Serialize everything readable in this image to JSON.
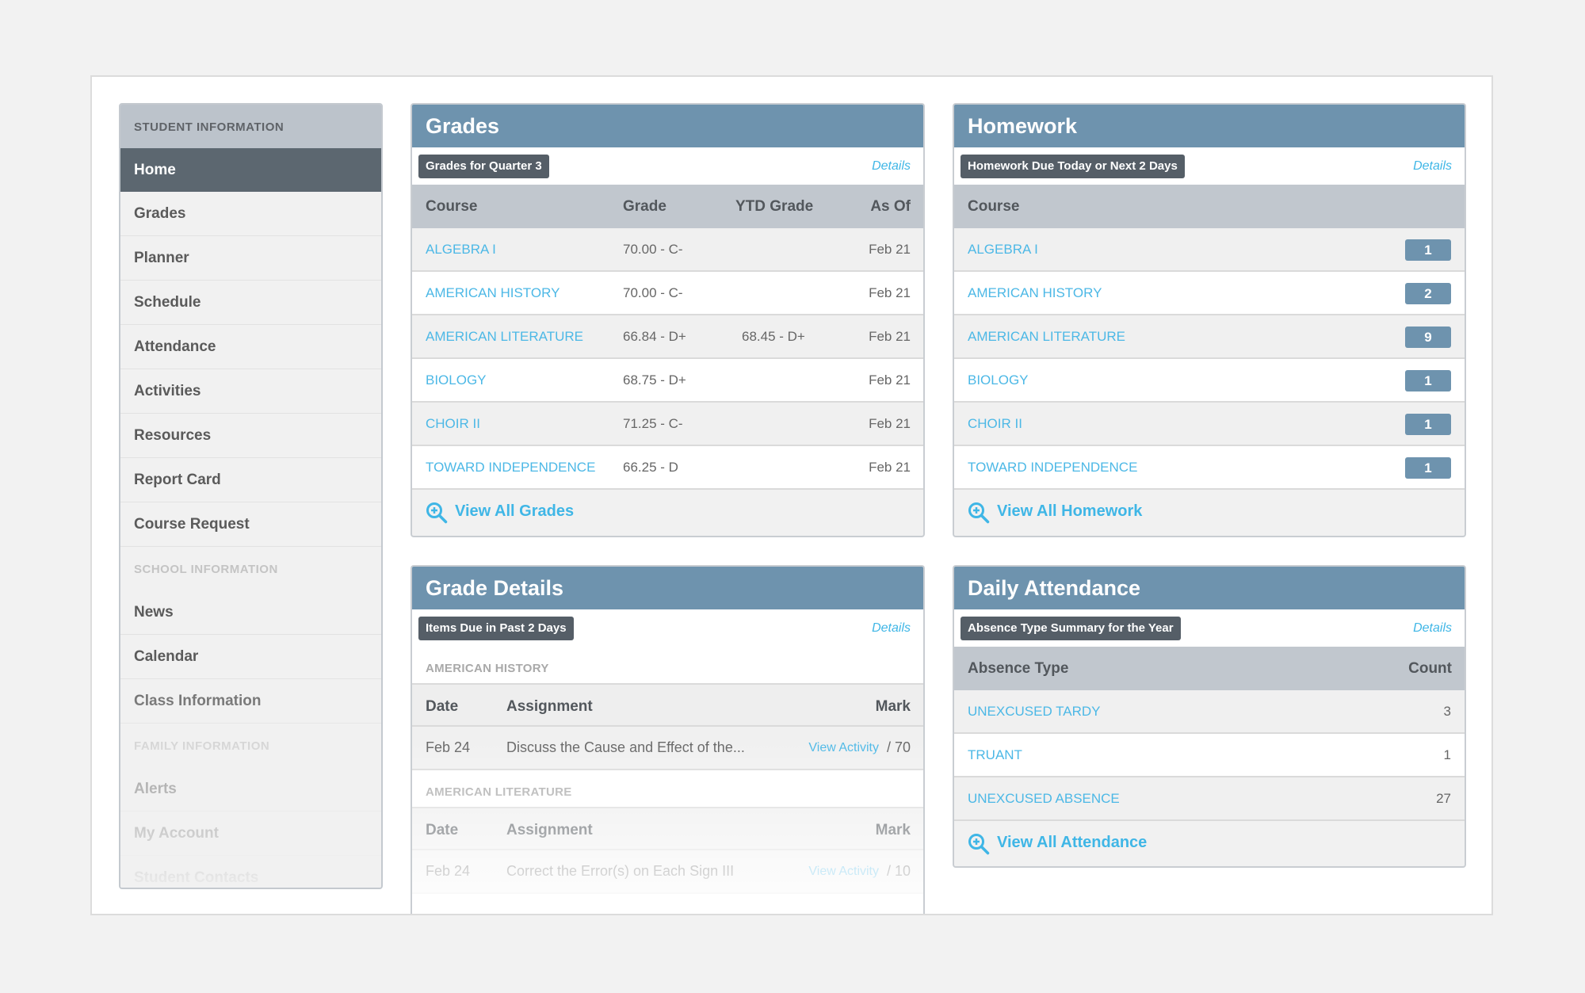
{
  "sidebar": {
    "sections": [
      {
        "title": "STUDENT INFORMATION",
        "items": [
          "Home",
          "Grades",
          "Planner",
          "Schedule",
          "Attendance",
          "Activities",
          "Resources",
          "Report Card",
          "Course Request"
        ]
      },
      {
        "title": "SCHOOL INFORMATION",
        "items": [
          "News",
          "Calendar",
          "Class Information"
        ]
      },
      {
        "title": "FAMILY INFORMATION",
        "items": [
          "Alerts",
          "My Account",
          "Student Contacts"
        ]
      }
    ],
    "active_item": "Home"
  },
  "grades": {
    "title": "Grades",
    "tag": "Grades for Quarter 3",
    "details": "Details",
    "columns": [
      "Course",
      "Grade",
      "YTD Grade",
      "As Of"
    ],
    "rows": [
      {
        "course": "ALGEBRA I",
        "grade": "70.00 - C-",
        "ytd": "",
        "asof": "Feb 21"
      },
      {
        "course": "AMERICAN HISTORY",
        "grade": "70.00 - C-",
        "ytd": "",
        "asof": "Feb 21"
      },
      {
        "course": "AMERICAN LITERATURE",
        "grade": "66.84 - D+",
        "ytd": "68.45 - D+",
        "asof": "Feb 21"
      },
      {
        "course": "BIOLOGY",
        "grade": "68.75 - D+",
        "ytd": "",
        "asof": "Feb 21"
      },
      {
        "course": "CHOIR II",
        "grade": "71.25 - C-",
        "ytd": "",
        "asof": "Feb 21"
      },
      {
        "course": "TOWARD INDEPENDENCE",
        "grade": "66.25 - D",
        "ytd": "",
        "asof": "Feb 21"
      }
    ],
    "footer": "View All Grades"
  },
  "homework": {
    "title": "Homework",
    "tag": "Homework Due Today or Next 2 Days",
    "details": "Details",
    "columns": [
      "Course"
    ],
    "rows": [
      {
        "course": "ALGEBRA I",
        "count": "1"
      },
      {
        "course": "AMERICAN HISTORY",
        "count": "2"
      },
      {
        "course": "AMERICAN LITERATURE",
        "count": "9"
      },
      {
        "course": "BIOLOGY",
        "count": "1"
      },
      {
        "course": "CHOIR II",
        "count": "1"
      },
      {
        "course": "TOWARD INDEPENDENCE",
        "count": "1"
      }
    ],
    "footer": "View All Homework"
  },
  "grade_details": {
    "title": "Grade Details",
    "tag": "Items Due in Past 2 Days",
    "details": "Details",
    "groups": [
      {
        "course": "AMERICAN HISTORY",
        "columns": [
          "Date",
          "Assignment",
          "Mark"
        ],
        "rows": [
          {
            "date": "Feb 24",
            "assignment": "Discuss the Cause and Effect of the...",
            "link": "View Activity",
            "mark": "/ 70"
          }
        ]
      },
      {
        "course": "AMERICAN LITERATURE",
        "columns": [
          "Date",
          "Assignment",
          "Mark"
        ],
        "rows": [
          {
            "date": "Feb 24",
            "assignment": "Correct the Error(s) on Each Sign III",
            "link": "View Activity",
            "mark": "/ 10"
          }
        ]
      }
    ]
  },
  "attendance": {
    "title": "Daily Attendance",
    "tag": "Absence Type Summary for the Year",
    "details": "Details",
    "columns": [
      "Absence Type",
      "Count"
    ],
    "rows": [
      {
        "type": "UNEXCUSED TARDY",
        "count": "3"
      },
      {
        "type": "TRUANT",
        "count": "1"
      },
      {
        "type": "UNEXCUSED ABSENCE",
        "count": "27"
      }
    ],
    "footer": "View All Attendance"
  },
  "colors": {
    "panel_header": "#6e93ae",
    "link": "#3fb6e6",
    "active_nav": "#5c6770",
    "tag": "#555e67"
  },
  "icons": {
    "footer_icon": "zoom-in-icon"
  }
}
